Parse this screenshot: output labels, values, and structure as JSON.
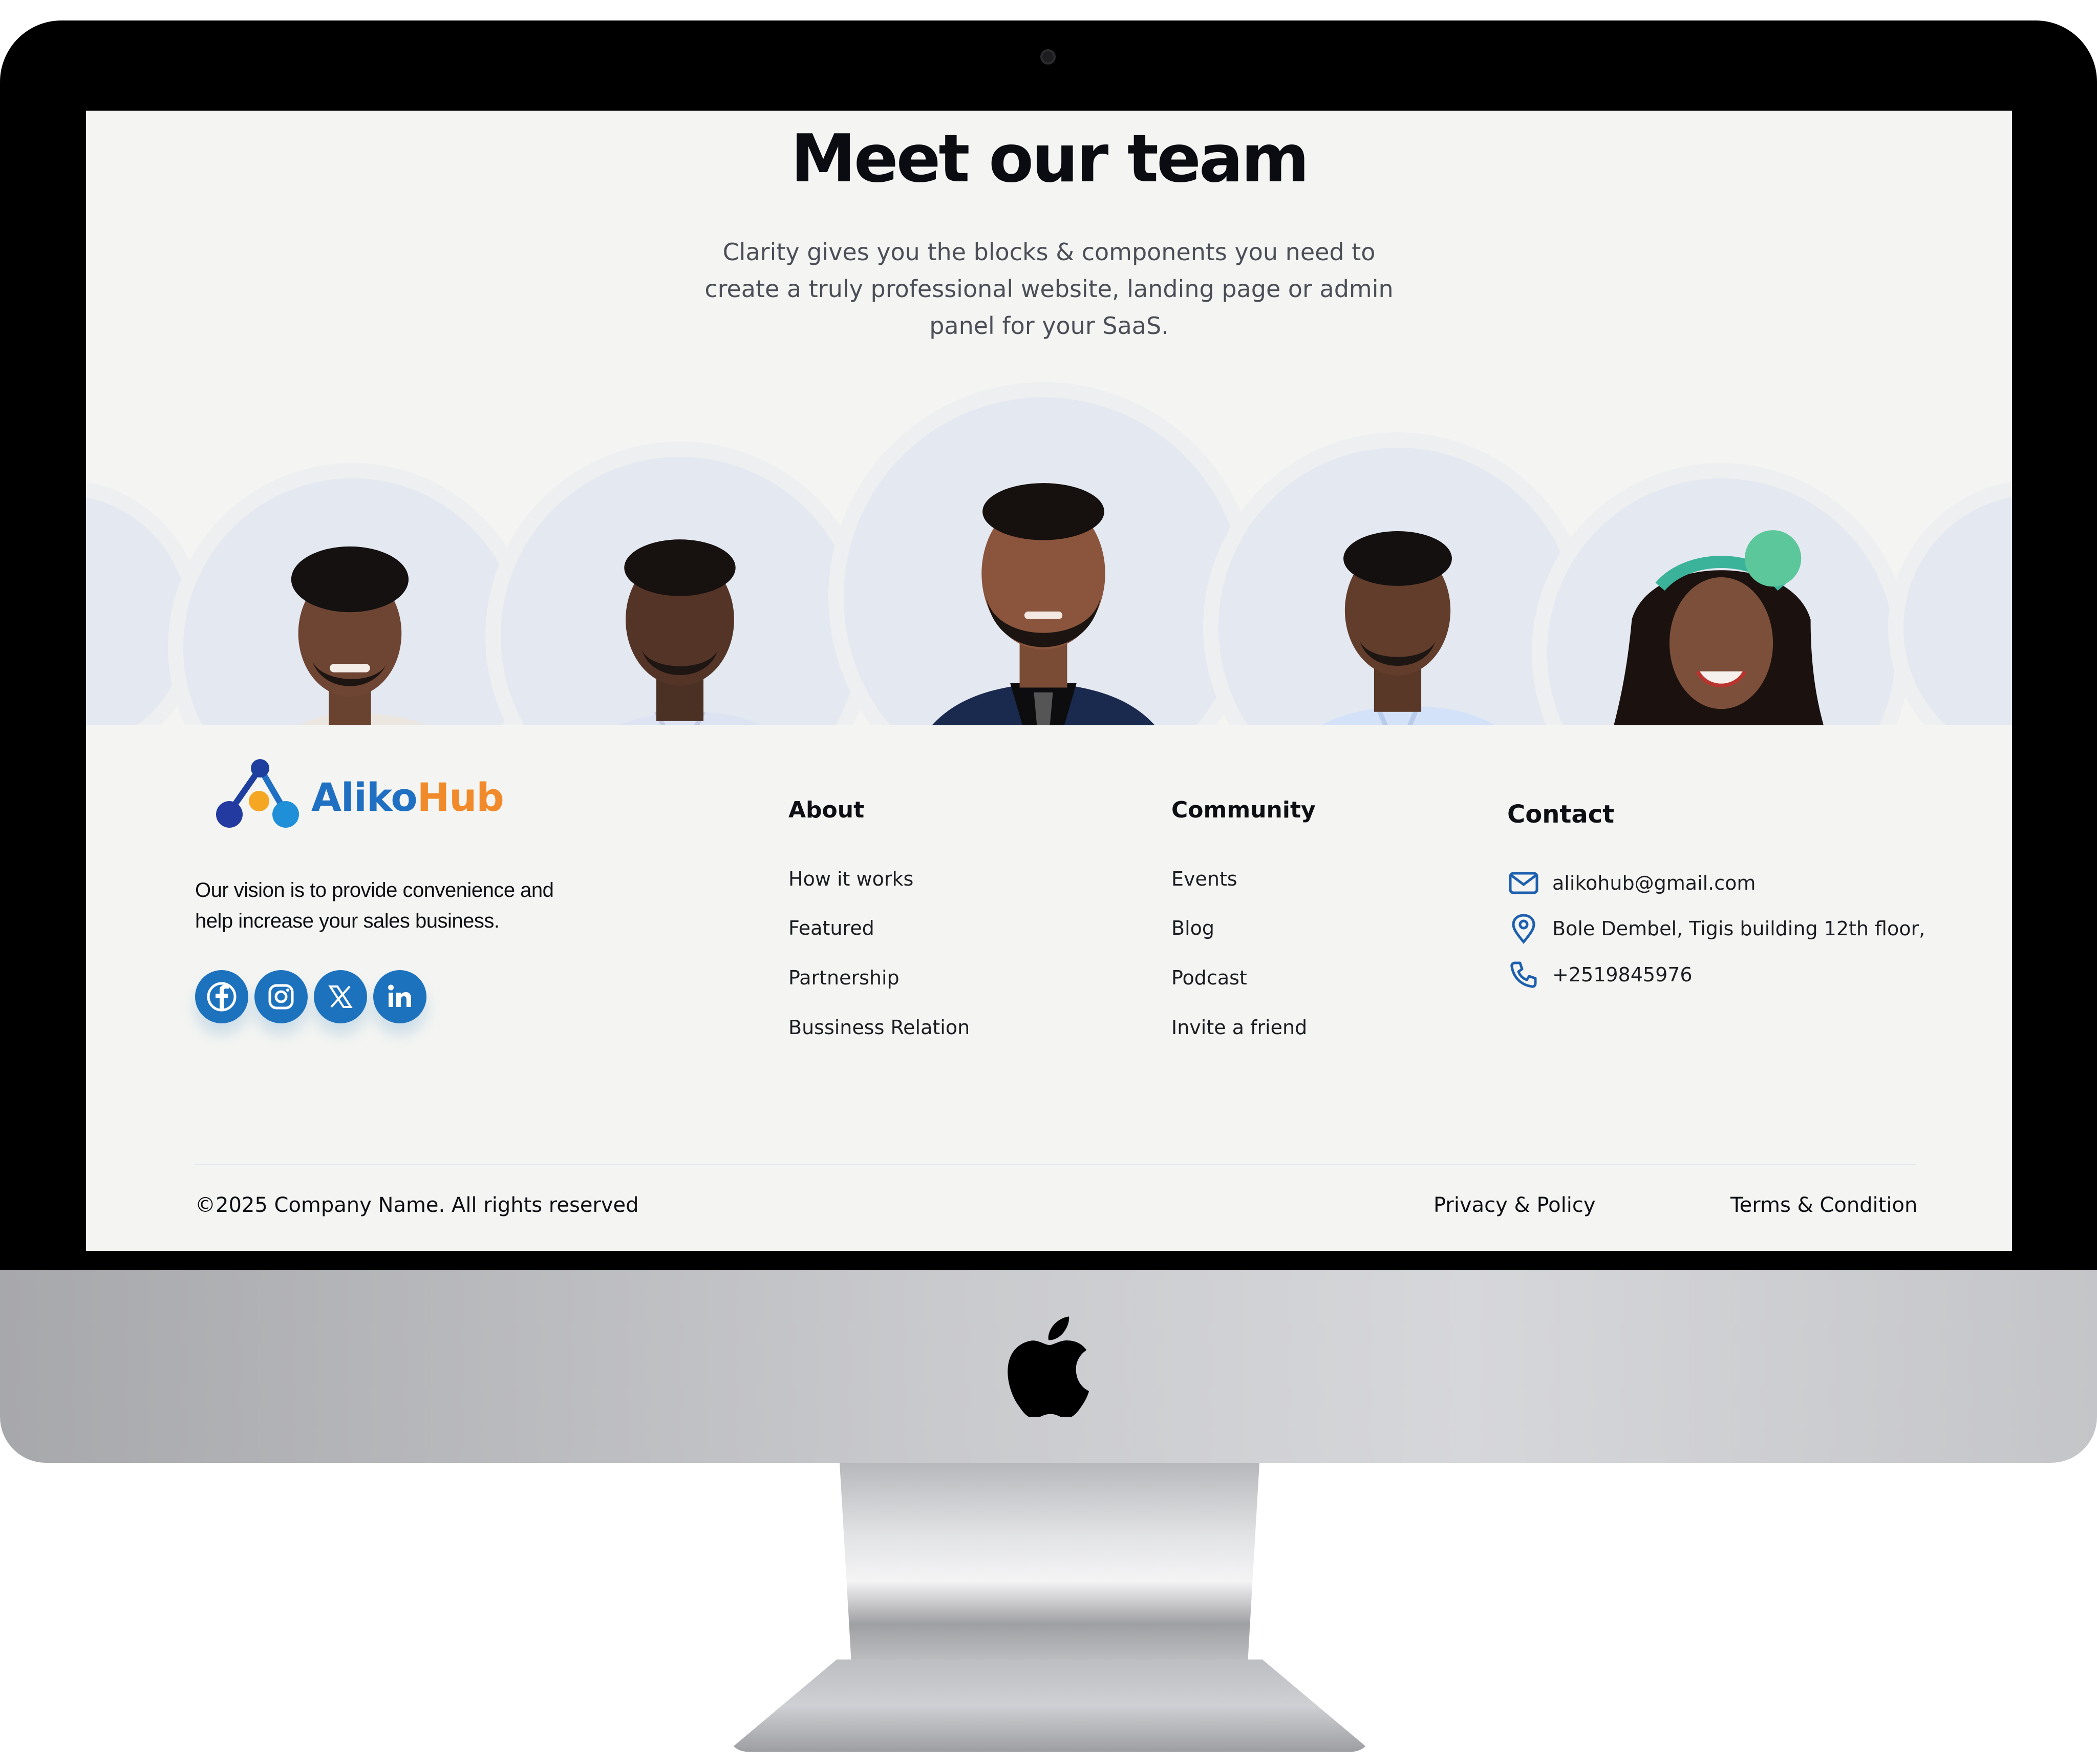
{
  "team": {
    "title": "Meet our team",
    "description": "Clarity gives you the blocks & components you need to create a truly professional website, landing page or admin panel for your SaaS."
  },
  "brand": {
    "name_part1": "Aliko",
    "name_part2": "Hub",
    "vision": "Our vision is to provide convenience and help increase your sales business."
  },
  "socials": [
    {
      "icon": "facebook-icon"
    },
    {
      "icon": "instagram-icon"
    },
    {
      "icon": "x-icon"
    },
    {
      "icon": "linkedin-icon"
    }
  ],
  "about": {
    "title": "About",
    "links": [
      "How it works",
      "Featured",
      "Partnership",
      "Bussiness Relation"
    ]
  },
  "community": {
    "title": "Community",
    "links": [
      "Events",
      "Blog",
      "Podcast",
      "Invite a friend"
    ]
  },
  "contact": {
    "title": "Contact",
    "email": "alikohub@gmail.com",
    "address": "Bole Dembel, Tigis building 12th floor,",
    "phone": "+2519845976"
  },
  "bottom": {
    "copyright": "©2025 Company Name. All rights reserved",
    "privacy": "Privacy & Policy",
    "terms": "Terms & Condition"
  },
  "colors": {
    "brand_blue": "#1f6fc2",
    "brand_orange": "#f08a2a",
    "social_blue": "#1d72be",
    "page_bg": "#f4f5f2"
  }
}
